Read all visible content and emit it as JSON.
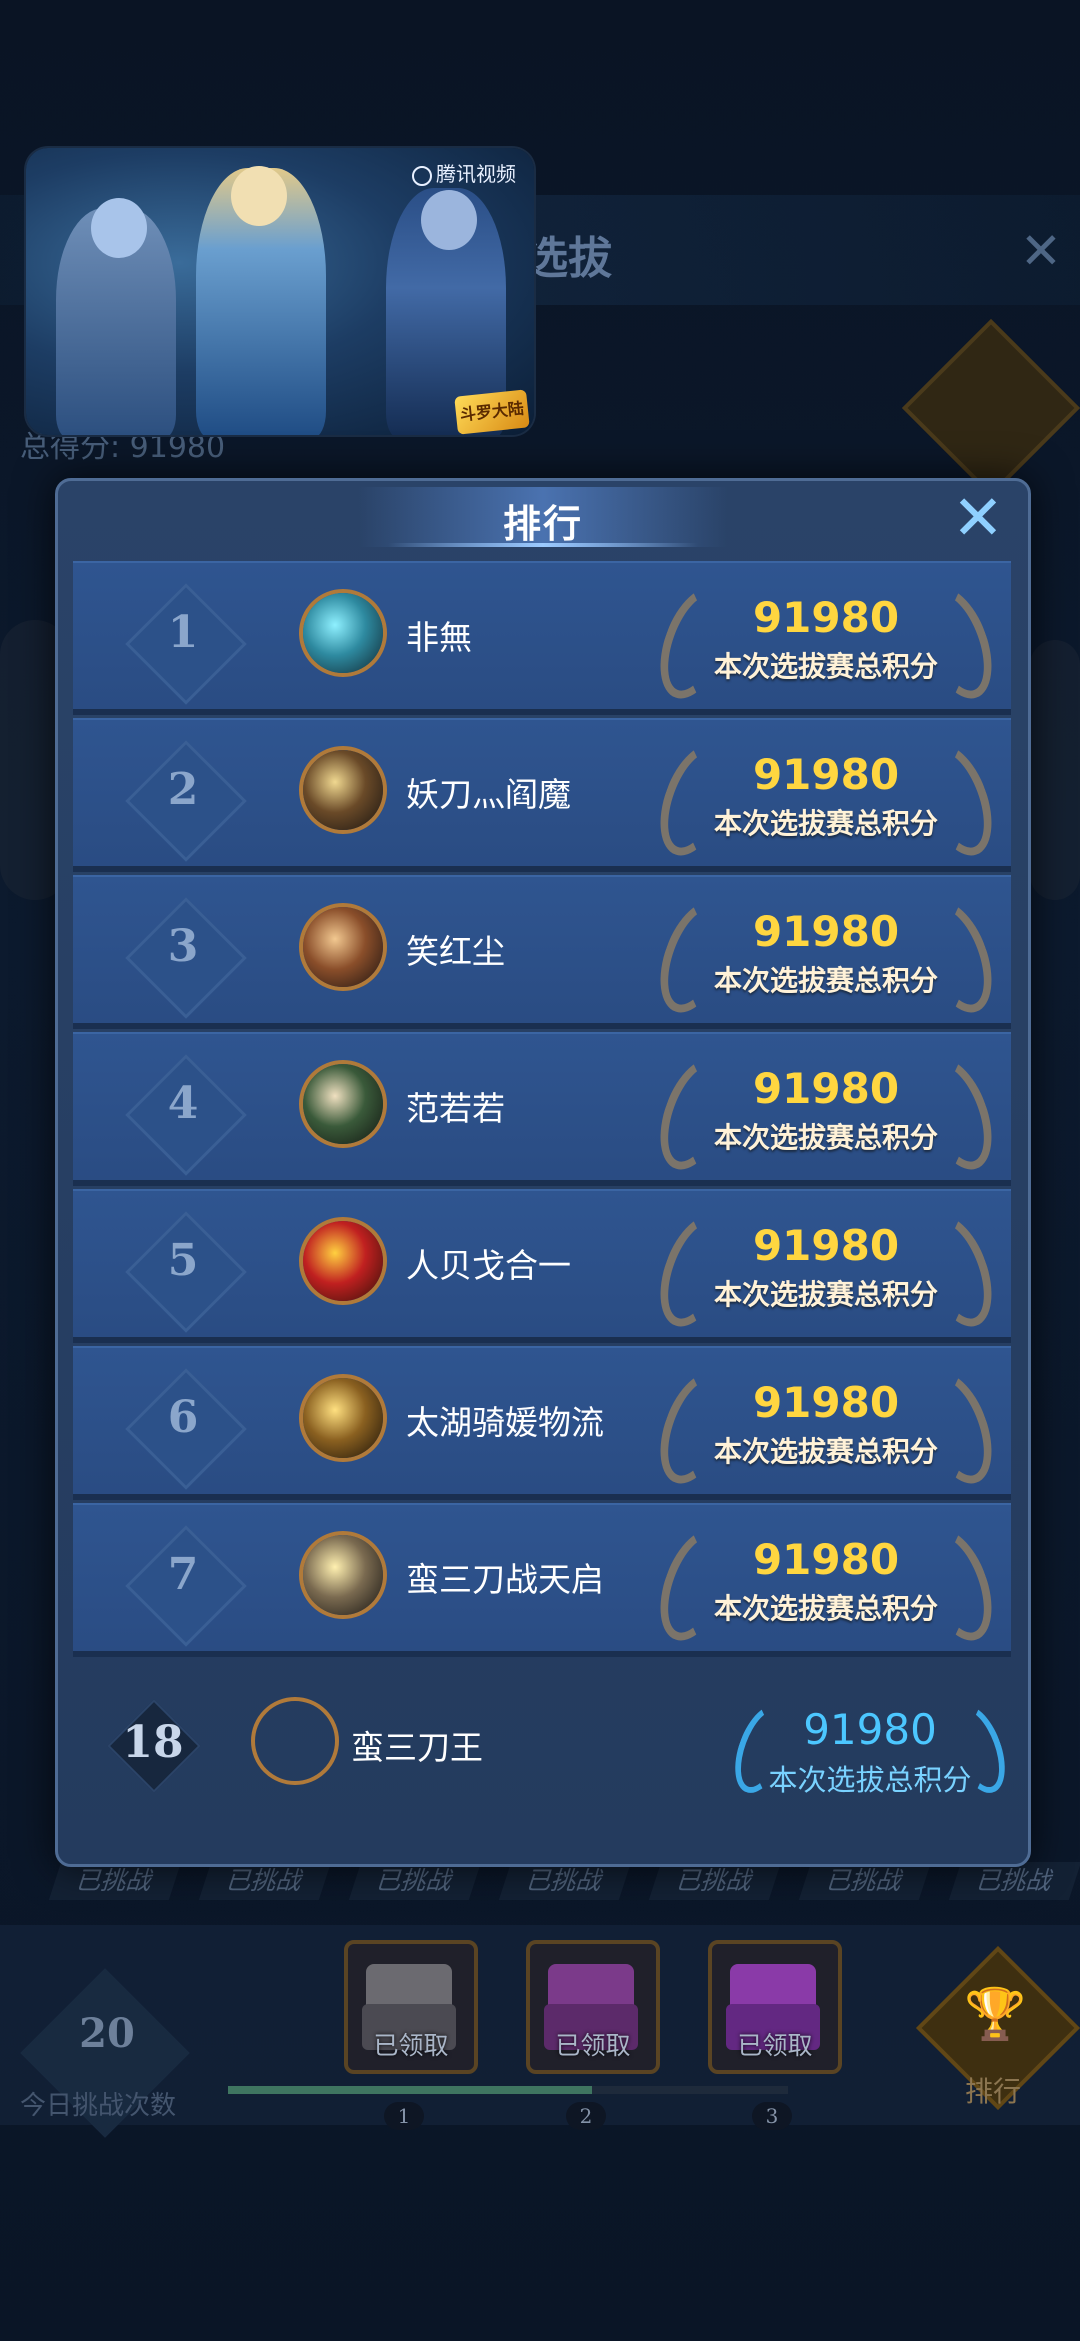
{
  "background": {
    "title_fragment": "战选拔",
    "close_glyph": "✕",
    "total_score": "总得分: 91980",
    "challenged_label": "已挑战",
    "challenged_count": 7,
    "today_count": "20",
    "today_label": "今日挑战次数",
    "chests": [
      {
        "label": "已领取",
        "milestone": "1"
      },
      {
        "label": "已领取",
        "milestone": "2"
      },
      {
        "label": "已领取",
        "milestone": "3"
      }
    ],
    "progress": 0.65,
    "rank_button_label": "排行",
    "rank_button_icon": "trophy-icon"
  },
  "video": {
    "watermark": "腾讯视频",
    "logo": "斗罗大陆"
  },
  "modal": {
    "title": "排行",
    "close_glyph": "✕",
    "score_label": "本次选拔赛总积分",
    "entries": [
      {
        "rank": "1",
        "name": "非無",
        "score": "91980"
      },
      {
        "rank": "2",
        "name": "妖刀灬阎魔",
        "score": "91980"
      },
      {
        "rank": "3",
        "name": "笑红尘",
        "score": "91980"
      },
      {
        "rank": "4",
        "name": "范若若",
        "score": "91980"
      },
      {
        "rank": "5",
        "name": "人贝戈合一",
        "score": "91980"
      },
      {
        "rank": "6",
        "name": "太湖骑媛物流",
        "score": "91980"
      },
      {
        "rank": "7",
        "name": "蛮三刀战天启",
        "score": "91980"
      }
    ],
    "self": {
      "rank": "18",
      "name": "蛮三刀王",
      "score": "91980",
      "score_label": "本次选拔总积分"
    },
    "colors": {
      "score": "#ffd640",
      "self_score": "#4cc7ff",
      "close": "#8fd0ff"
    }
  }
}
